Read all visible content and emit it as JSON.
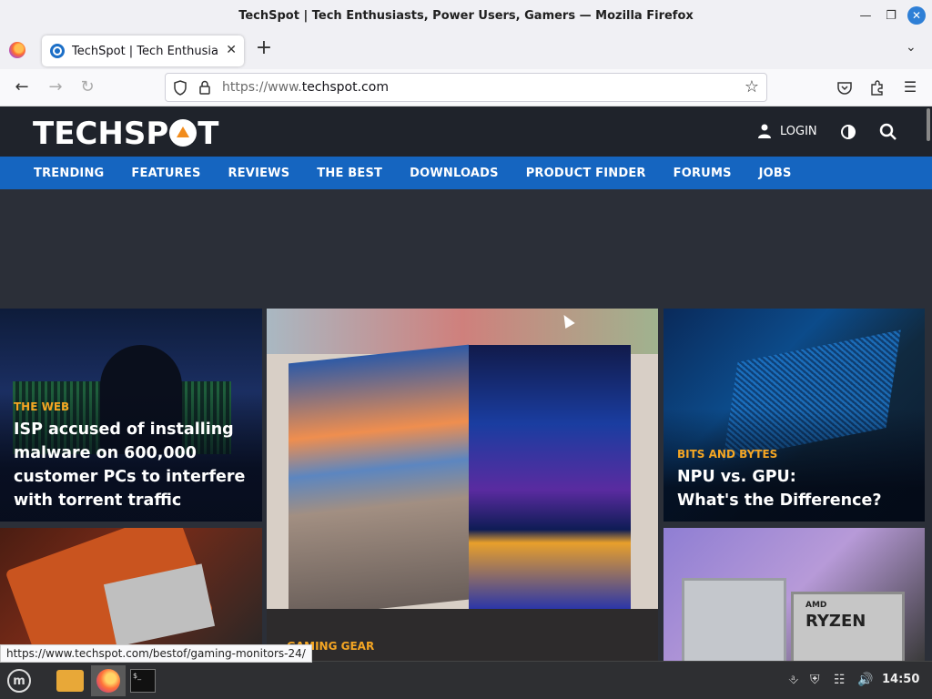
{
  "window": {
    "title": "TechSpot | Tech Enthusiasts, Power Users, Gamers — Mozilla Firefox"
  },
  "tabs": [
    {
      "label": "TechSpot | Tech Enthusiasts, Power Users, Gamers",
      "active": true
    }
  ],
  "navbar": {
    "url_prefix": "https://www.",
    "url_domain": "techspot.com"
  },
  "site": {
    "logo": "TECHSPOT",
    "login_label": "LOGIN",
    "nav_items": [
      "TRENDING",
      "FEATURES",
      "REVIEWS",
      "THE BEST",
      "DOWNLOADS",
      "PRODUCT FINDER",
      "FORUMS",
      "JOBS"
    ]
  },
  "cards": {
    "card1": {
      "category": "THE WEB",
      "headline": "ISP accused of installing malware on 600,000 customer PCs to interfere with torrent traffic"
    },
    "card3": {
      "category": "BITS AND BYTES",
      "headline_line1": "NPU vs. GPU:",
      "headline_line2": "What's the Difference?"
    },
    "card_mid": {
      "category": "GAMING GEAR"
    },
    "card5": {
      "brand": "AMD",
      "product": "RYZEN"
    }
  },
  "status_link": "https://www.techspot.com/bestof/gaming-monitors-24/",
  "taskbar": {
    "clock": "14:50"
  },
  "colors": {
    "accent": "#1565c0",
    "category": "#f5a623",
    "header_bg": "#1f232b"
  }
}
